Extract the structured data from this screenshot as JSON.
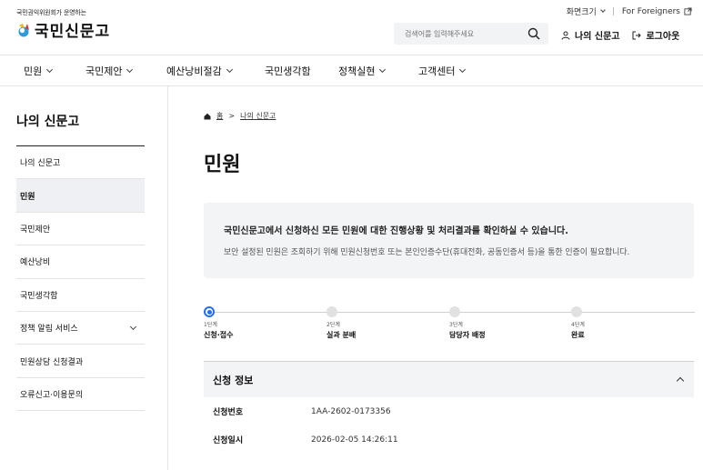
{
  "header": {
    "logo_sub": "국민권익위원회가 운영하는",
    "logo_text": "국민신문고",
    "util": {
      "screen_size": "화면크기",
      "foreigners": "For Foreigners"
    },
    "search": {
      "placeholder": "검색어를 입력해주세요"
    },
    "my_link": "나의 신문고",
    "logout": "로그아웃"
  },
  "gnb": [
    {
      "label": "민원"
    },
    {
      "label": "국민제안"
    },
    {
      "label": "예산낭비절감"
    },
    {
      "label": "국민생각함"
    },
    {
      "label": "정책실현"
    },
    {
      "label": "고객센터"
    }
  ],
  "sidebar": {
    "title": "나의 신문고",
    "items": [
      {
        "label": "나의 신문고"
      },
      {
        "label": "민원"
      },
      {
        "label": "국민제안"
      },
      {
        "label": "예산낭비"
      },
      {
        "label": "국민생각함"
      },
      {
        "label": "정책 알림 서비스"
      },
      {
        "label": "민원상담 신청결과"
      },
      {
        "label": "오류신고·이용문의"
      }
    ]
  },
  "breadcrumb": {
    "home": "홈",
    "current": "나의 신문고"
  },
  "page_title": "민원",
  "notice": {
    "title": "국민신문고에서 신청하신 모든 민원에 대한 진행상황 및 처리결과를 확인하실 수 있습니다.",
    "desc": "보안 설정된 민원은 조회하기 위해 민원신청번호 또는 본인인증수단(휴대전화, 공동인증서 등)을 통한 인증이 필요합니다."
  },
  "steps": [
    {
      "num": "1단계",
      "label": "신청·접수"
    },
    {
      "num": "2단계",
      "label": "실과 분배"
    },
    {
      "num": "3단계",
      "label": "담당자 배정"
    },
    {
      "num": "4단계",
      "label": "완료"
    }
  ],
  "active_step": 1,
  "info": {
    "title": "신청 정보",
    "rows": [
      {
        "label": "신청번호",
        "value": "1AA-2602-0173356"
      },
      {
        "label": "신청일시",
        "value": "2026-02-05 14:26:11"
      }
    ]
  },
  "colors": {
    "accent": "#256ef4"
  }
}
